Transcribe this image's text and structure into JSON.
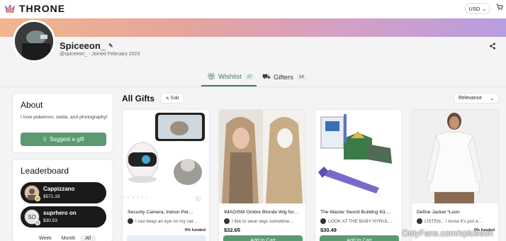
{
  "nav": {
    "logo_text": "THRONE",
    "currency": "USD",
    "cart_icon": "cart-icon"
  },
  "profile": {
    "name": "Spiceeon_",
    "handle_joined": "@spiceeon_ - Joined February 2023"
  },
  "tabs": [
    {
      "label": "Wishlist",
      "count": "27",
      "active": true
    },
    {
      "label": "Gifters",
      "count": "14",
      "active": false
    }
  ],
  "about": {
    "title": "About",
    "text": "I love pokemon, zelda, and photography!",
    "suggest_label": "Suggest a gift"
  },
  "leaderboard": {
    "title": "Leaderboard",
    "entries": [
      {
        "name": "Cappizzano",
        "amount": "$571.18",
        "avatar_text": ""
      },
      {
        "name": "suprhero on",
        "amount": "$30.53",
        "avatar_text": "SO"
      }
    ],
    "periods": [
      "Week",
      "Month",
      "All"
    ],
    "active_period": "All"
  },
  "gifts": {
    "title": "All Gifts",
    "edit_label": "Edit",
    "sort_label": "Relevance",
    "items": [
      {
        "title": "Security Camera, Indoor Pet…",
        "note": "I can keep an eye on my cat…",
        "price": "",
        "funded": "0% funded",
        "button": ""
      },
      {
        "title": "IMAGISM Ombre Blonde Wig for…",
        "note": "I like to wear wigs sometime…",
        "price": "$32.65",
        "funded": "",
        "button": "Add to Cart"
      },
      {
        "title": "The Master Sword Building Kit,…",
        "note": "LOOK AT THE BABY HYRUL…",
        "price": "$30.49",
        "funded": "",
        "button": "Add to Cart"
      },
      {
        "title": "Define Jacket *Luon",
        "note": "LISTEN... I know it's just a…",
        "price": "",
        "funded": "0% funded",
        "button": ""
      }
    ]
  },
  "watermark": "OnlyFans.com/spiceeon",
  "colors": {
    "accent": "#5c9a71",
    "tab_active": "#3a7d54",
    "leader_bg": "#1a1a1a"
  }
}
